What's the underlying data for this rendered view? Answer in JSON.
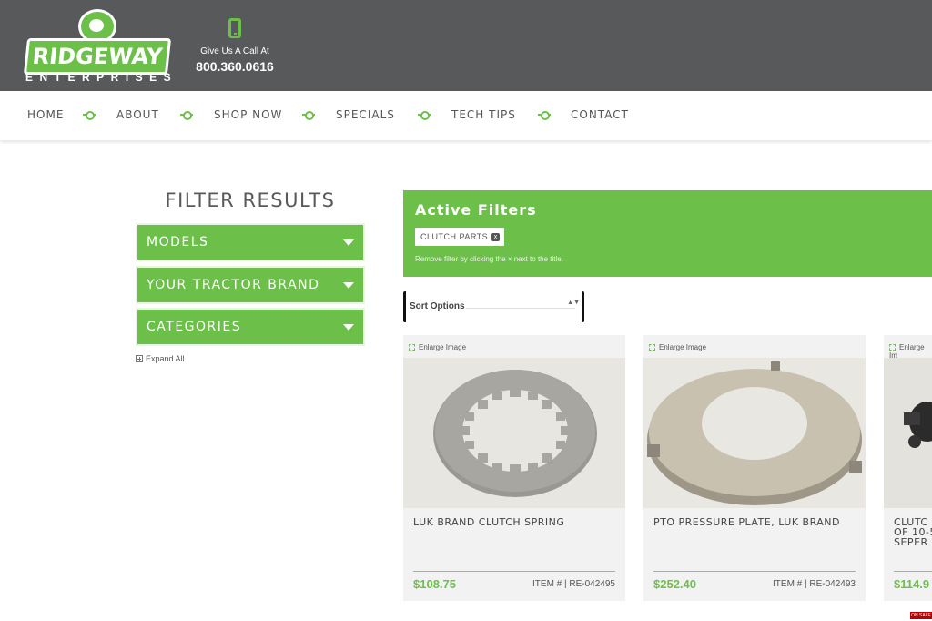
{
  "header": {
    "logo_main": "RIDGEWAY",
    "logo_sub": "ENTERPRISES",
    "call_label": "Give Us A Call At",
    "phone": "800.360.0616"
  },
  "nav": [
    "HOME",
    "ABOUT",
    "SHOP NOW",
    "SPECIALS",
    "TECH TIPS",
    "CONTACT"
  ],
  "filters": {
    "title": "FILTER RESULTS",
    "facets": [
      "MODELS",
      "YOUR TRACTOR BRAND",
      "CATEGORIES"
    ],
    "expand_all": "Expand All"
  },
  "active_filters": {
    "title": "Active Filters",
    "chip": "CLUTCH PARTS",
    "chip_remove": "x",
    "hint": "Remove filter by clicking the × next to the title."
  },
  "sort": {
    "label": "Sort Options",
    "arrows": "▲▼"
  },
  "products": [
    {
      "enlarge": "Enlarge Image",
      "name": "LUK BRAND CLUTCH SPRING",
      "price": "$108.75",
      "item": "ITEM # | RE-042495"
    },
    {
      "enlarge": "Enlarge Image",
      "name": "PTO PRESSURE PLATE, LUK BRAND",
      "price": "$252.40",
      "item": "ITEM # | RE-042493"
    },
    {
      "enlarge": "Enlarge Im",
      "name": "CLUTC\nOF 10-5\nSEPER",
      "price": "$114.9",
      "item": ""
    }
  ],
  "sale_badge": "ON SALE",
  "colors": {
    "brand_green": "#6cc04a",
    "header_gray": "#58595b"
  }
}
